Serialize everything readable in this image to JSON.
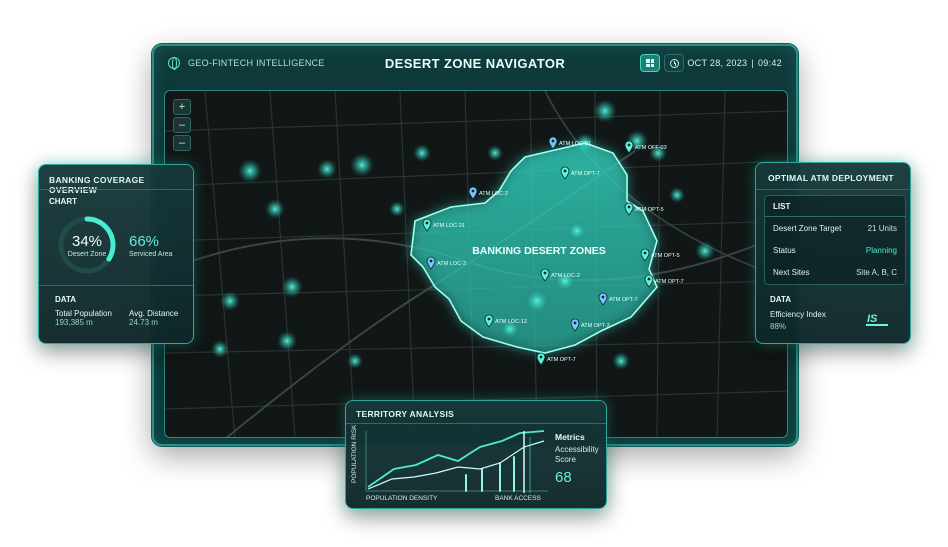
{
  "header": {
    "brand": "GEO-FINTECH INTELLIGENCE",
    "title": "DESERT ZONE NAVIGATOR",
    "date": "OCT 28, 2023",
    "separator": "|",
    "time": "09:42",
    "icons": [
      "qr-grid-icon",
      "clock-icon"
    ]
  },
  "map": {
    "zoom_in": "+",
    "zoom_separator": "–",
    "zoom_out": "–",
    "zone_label": "BANKING DESERT ZONES",
    "markers": [
      "ATM LOC-51",
      "ATM OFF-03",
      "ATM OPT-7",
      "ATM LOC-2",
      "ATM OPT-5",
      "ATM LOC-21",
      "ATM LOC-3",
      "ATM OPT-5",
      "ATM LOC-2",
      "ATM OPT-7",
      "ATM OPT-7",
      "ATM LOC-12",
      "ATM OPT-3",
      "ATM OPT-7"
    ]
  },
  "coverage": {
    "title": "BANKING COVERAGE OVERVIEW",
    "chart_title": "CHART",
    "desert_pct": "34%",
    "desert_label": "Desert Zone",
    "desert_fraction": 0.34,
    "serviced_pct": "66%",
    "serviced_label": "Serviced Area",
    "data_title": "DATA",
    "population_label": "Total Population",
    "population_value": "193,385 m",
    "distance_label": "Avg. Distance",
    "distance_value": "24.73 m"
  },
  "atm": {
    "title": "OPTIMAL ATM DEPLOYMENT",
    "list_title": "LIST",
    "rows": [
      {
        "label": "Desert Zone Target",
        "value": "21 Units"
      },
      {
        "label": "Status",
        "value": "Planning"
      },
      {
        "label": "Next Sites",
        "value": "Site A, B, C"
      }
    ],
    "data_title": "DATA",
    "efficiency_label": "Efficiency Index",
    "efficiency_value": "88%",
    "logo_text": "IS"
  },
  "territory": {
    "title": "TERRITORY ANALYSIS",
    "y_label": "POPULATION RISK",
    "x_label_1": "POPULATION DENSITY",
    "x_label_2": "BANK ACCESS",
    "metrics_title": "Metrics",
    "metrics_label": "Accessibility Score",
    "metrics_value": "68"
  },
  "colors": {
    "accent": "#3fe6cf",
    "panel": "#0f2c2e",
    "border": "#2ca79a"
  }
}
